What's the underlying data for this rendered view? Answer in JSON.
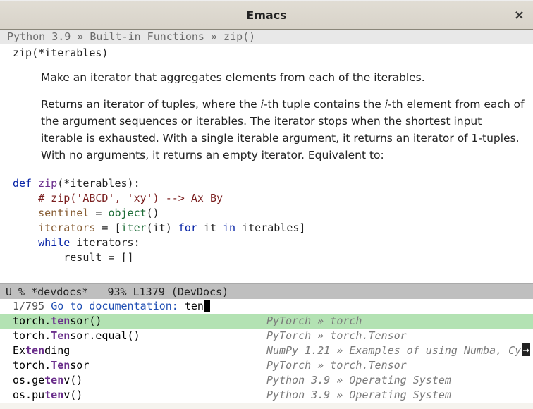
{
  "window": {
    "title": "Emacs",
    "close_glyph": "×"
  },
  "breadcrumb": "Python 3.9 » Built-in Functions » zip()",
  "doc": {
    "signature": "zip(*iterables)",
    "para1": "Make an iterator that aggregates elements from each of the iterables.",
    "para2_pre": "Returns an iterator of tuples, where the ",
    "para2_i1": "i",
    "para2_mid1": "-th tuple contains the ",
    "para2_i2": "i",
    "para2_mid2": "-th element from each of the argument sequences or iterables. The iterator stops when the shortest input iterable is exhausted. With a single iterable argument, it returns an iterator of 1-tuples. With no arguments, it returns an empty iterator. Equivalent to:"
  },
  "code": {
    "l1_def": "def",
    "l1_name": "zip",
    "l1_rest": "(*iterables):",
    "l2": "# zip('ABCD', 'xy') --> Ax By",
    "l3_var": "sentinel",
    "l3_eq": " = ",
    "l3_fn": "object",
    "l3_rest": "()",
    "l4_var": "iterators",
    "l4_eq": " = [",
    "l4_fn": "iter",
    "l4_mid1": "(it) ",
    "l4_for": "for",
    "l4_mid2": " it ",
    "l4_in": "in",
    "l4_rest": " iterables]",
    "l5_kw": "while",
    "l5_rest": " iterators:",
    "l6": "result = []"
  },
  "modeline": "U % *devdocs*   93% L1379 (DevDocs)",
  "minibuffer": {
    "count": "1/795",
    "prompt": "Go to documentation:",
    "query": "ten"
  },
  "candidates": [
    {
      "left_pre": "torch.",
      "left_hl": "ten",
      "left_post": "sor()",
      "right": "PyTorch » torch",
      "selected": true
    },
    {
      "left_pre": "torch.",
      "left_hl": "Ten",
      "left_post": "sor.equal()",
      "right": "PyTorch » torch.Tensor"
    },
    {
      "left_pre": "Ex",
      "left_hl": "ten",
      "left_post": "ding",
      "right": "NumPy 1.21 » Examples of using Numba, Cy",
      "overflow": true
    },
    {
      "left_pre": "torch.",
      "left_hl": "Ten",
      "left_post": "sor",
      "right": "PyTorch » torch.Tensor"
    },
    {
      "left_pre": "os.ge",
      "left_hl": "ten",
      "left_post": "v()",
      "right": "Python 3.9 » Operating System"
    },
    {
      "left_pre": "os.pu",
      "left_hl": "ten",
      "left_post": "v()",
      "right": "Python 3.9 » Operating System"
    }
  ]
}
